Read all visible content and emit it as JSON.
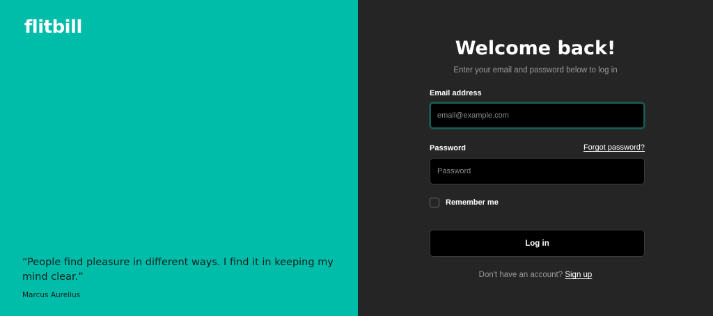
{
  "brand": {
    "logo_text": "flitbill",
    "primary_color": "#00BDAA",
    "dark_panel_color": "#262525"
  },
  "quote": {
    "text": "“People find pleasure in different ways. I find it in keeping my mind clear.”",
    "author": "Marcus Aurelius"
  },
  "login": {
    "title": "Welcome back!",
    "subtitle": "Enter your email and password below to log in",
    "email_label": "Email address",
    "email_placeholder": "email@example.com",
    "email_value": "",
    "password_label": "Password",
    "forgot_password": "Forgot password?",
    "password_placeholder": "Password",
    "password_value": "",
    "remember_me": "Remember me",
    "remember_checked": false,
    "login_button": "Log in",
    "no_account_text": "Don't have an account?",
    "signup_link": "Sign up"
  }
}
